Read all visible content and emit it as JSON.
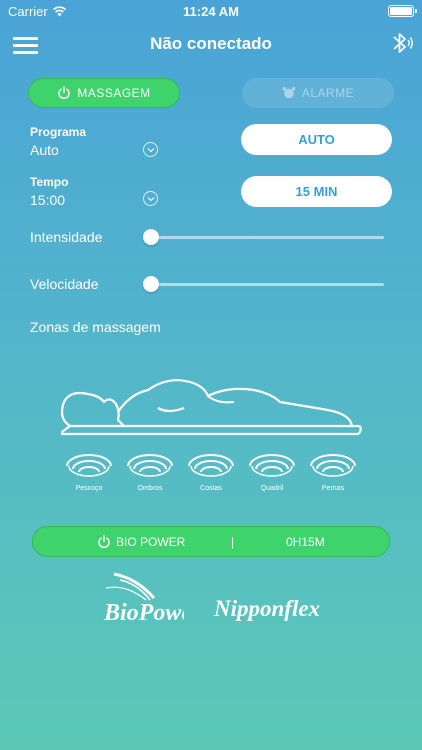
{
  "status": {
    "carrier": "Carrier",
    "time": "11:24 AM"
  },
  "header": {
    "title": "Não conectado"
  },
  "top_buttons": {
    "massage": "MASSAGEM",
    "alarm": "ALARME"
  },
  "program": {
    "label": "Programa",
    "value": "Auto",
    "button": "AUTO"
  },
  "time_setting": {
    "label": "Tempo",
    "value": "15:00",
    "button": "15 MIN"
  },
  "sliders": [
    {
      "label": "Intensidade",
      "level": 0
    },
    {
      "label": "Velocidade",
      "level": 0
    }
  ],
  "zones": {
    "title": "Zonas de massagem",
    "items": [
      "Pescoço",
      "Ombros",
      "Costas",
      "Quadril",
      "Pernas"
    ]
  },
  "power": {
    "label": "BIO POWER",
    "separator": "|",
    "time": "0H15M"
  },
  "logos": {
    "biopower": "BioPower",
    "nipponflex": "Nipponflex"
  },
  "colors": {
    "accent_green": "#3fd36b",
    "button_text": "#3a9fcf"
  }
}
